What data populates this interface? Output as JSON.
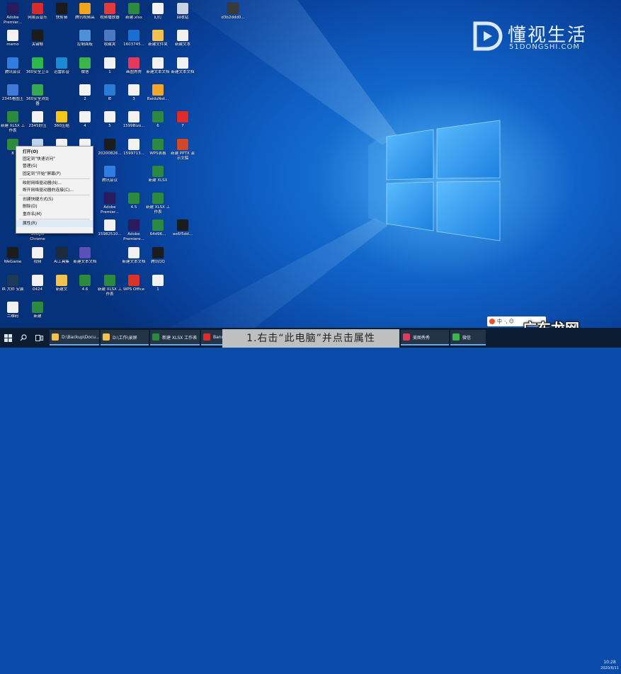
{
  "desktop_icons": [
    {
      "label": "Adobe Premier...",
      "color": "#2a1a5e"
    },
    {
      "label": "网易云音乐",
      "color": "#d62b2b"
    },
    {
      "label": "快剪辑",
      "color": "#1b1b1b"
    },
    {
      "label": "腾讯视频高",
      "color": "#f2a41c"
    },
    {
      "label": "视频播放器",
      "color": "#e33b3b"
    },
    {
      "label": "新建.xlsx",
      "color": "#2b8a3e"
    },
    {
      "label": "幻灯",
      "color": "#f2f2f2"
    },
    {
      "label": "回收站",
      "color": "#c8d4e0"
    },
    {
      "label": "d3b2ddd0...",
      "color": "#3a3a3a"
    },
    {
      "label": "memo",
      "color": "#f2f2f2"
    },
    {
      "label": "关键帧",
      "color": "#1c1c1c"
    },
    {
      "label": "控制面板",
      "color": "#4f8fd6"
    },
    {
      "label": "收藏夹",
      "color": "#4a78c2"
    },
    {
      "label": "1603745...",
      "color": "#1a6fd1"
    },
    {
      "label": "新建文件夹",
      "color": "#f2c14e"
    },
    {
      "label": "新建文本",
      "color": "#f2f2f2"
    },
    {
      "label": "腾讯会议",
      "color": "#2f7de1"
    },
    {
      "label": "360安全卫士",
      "color": "#2db84b"
    },
    {
      "label": "迅雷影音",
      "color": "#1a8ad4"
    },
    {
      "label": "微信",
      "color": "#3bb54a"
    },
    {
      "label": "1",
      "color": "#f2f2f2"
    },
    {
      "label": "画图秀秀",
      "color": "#e23a5c"
    },
    {
      "label": "新建文本文档",
      "color": "#f2f2f2"
    },
    {
      "label": "新建文本文档",
      "color": "#f2f2f2"
    },
    {
      "label": "2345看图王",
      "color": "#3f7ad8"
    },
    {
      "label": "360安全浏览器",
      "color": "#35a852"
    },
    {
      "label": "2",
      "color": "#f2f2f2"
    },
    {
      "label": "IE",
      "color": "#2a7bd6"
    },
    {
      "label": "3",
      "color": "#f2f2f2"
    },
    {
      "label": "BaiduNet...",
      "color": "#f2a62b"
    },
    {
      "label": "新建 XLSX 工作表",
      "color": "#2b8a3e"
    },
    {
      "label": "2345好压",
      "color": "#f2f2f2"
    },
    {
      "label": "360压缩",
      "color": "#f5c518"
    },
    {
      "label": "4",
      "color": "#f2f2f2"
    },
    {
      "label": "5",
      "color": "#f2f2f2"
    },
    {
      "label": "1599Bizo...",
      "color": "#f2f2f2"
    },
    {
      "label": "6",
      "color": "#2b8a3e"
    },
    {
      "label": "7",
      "color": "#e02b2b"
    },
    {
      "label": "8",
      "color": "#2b8a3e"
    },
    {
      "label": "此电脑",
      "color": "#bcd3ea"
    },
    {
      "label": "2",
      "color": "#f2f2f2"
    },
    {
      "label": "3",
      "color": "#f2f2f2"
    },
    {
      "label": "20200826...",
      "color": "#1c1c1c"
    },
    {
      "label": "1599713...",
      "color": "#f2f2f2"
    },
    {
      "label": "WPS表格",
      "color": "#2b8a3e"
    },
    {
      "label": "新建 PPTX 演示文稿",
      "color": "#d24726"
    },
    {
      "label": "腾讯会议",
      "color": "#2f7de1"
    },
    {
      "label": "新建 XLSX",
      "color": "#2b8a3e"
    },
    {
      "label": "Adobe Premier...",
      "color": "#2a1a5e"
    },
    {
      "label": "4.5",
      "color": "#2b8a3e"
    },
    {
      "label": "新建 XLSX 工作表",
      "color": "#2b8a3e"
    },
    {
      "label": "Google Chrome",
      "color": "#e8b21c"
    },
    {
      "label": "15982510...",
      "color": "#f2f2f2"
    },
    {
      "label": "Adobe Premiere...",
      "color": "#2a1a5e"
    },
    {
      "label": "64d96...",
      "color": "#2b8a3e"
    },
    {
      "label": "ee6f5dd...",
      "color": "#1c1c1c"
    },
    {
      "label": "WeGame",
      "color": "#1c1c1c"
    },
    {
      "label": "视频",
      "color": "#f2f2f2"
    },
    {
      "label": "Ai工具集",
      "color": "#1c2b3a"
    },
    {
      "label": "新建文本文档",
      "color": "#5b4fb8"
    },
    {
      "label": "新建文本文档",
      "color": "#f2f2f2"
    },
    {
      "label": "腾讯QQ",
      "color": "#1c1c1c"
    },
    {
      "label": "IR 大师 安装",
      "color": "#1c3b5a"
    },
    {
      "label": "0424",
      "color": "#f2f2f2"
    },
    {
      "label": "新建文",
      "color": "#f2c14e"
    },
    {
      "label": "4.6",
      "color": "#2b8a3e"
    },
    {
      "label": "新建 XLSX 工作表",
      "color": "#2b8a3e"
    },
    {
      "label": "WPS Office",
      "color": "#d8342a"
    },
    {
      "label": "1",
      "color": "#f2f2f2"
    },
    {
      "label": "二维码",
      "color": "#f2f2f2"
    },
    {
      "label": "新建",
      "color": "#2b8a3e"
    }
  ],
  "context_menu": {
    "items": [
      {
        "label": "打开(O)",
        "bold": true
      },
      {
        "label": "固定到\"快速访问\"",
        "bold": false
      },
      {
        "label": "管理(G)",
        "bold": false
      },
      {
        "label": "固定到\"开始\"屏幕(P)",
        "bold": false
      },
      {
        "separator": true
      },
      {
        "label": "映射网络驱动器(N)...",
        "bold": false
      },
      {
        "label": "断开网络驱动器的连接(C)...",
        "bold": false
      },
      {
        "separator": true
      },
      {
        "label": "创建快捷方式(S)",
        "bold": false
      },
      {
        "label": "删除(D)",
        "bold": false
      },
      {
        "label": "重命名(M)",
        "bold": false
      },
      {
        "separator": true
      },
      {
        "label": "属性(R)",
        "bold": false,
        "highlighted": true
      }
    ]
  },
  "brand": {
    "name_cn": "懂视生活",
    "name_en": "51DONGSHI.COM"
  },
  "taskbar": {
    "items": [
      {
        "label": "D:\\Backup\\Docu...",
        "color": "#f2c14e"
      },
      {
        "label": "D:\\工作\\录屏",
        "color": "#f2c14e"
      },
      {
        "label": "新建 XLSX 工作表",
        "color": "#2b8a3e"
      },
      {
        "label": "Bandic...",
        "color": "#e02b2b"
      },
      {
        "label": "美图秀秀",
        "color": "#e23a5c"
      },
      {
        "label": "微信",
        "color": "#3bb54a"
      }
    ],
    "clock_time": "10:28",
    "clock_date": "2020/6/11"
  },
  "ime_bar": {
    "label": "中",
    "extra": "·, ☺"
  },
  "subtitle": "1.右击“此电脑”并点击属性",
  "watermark": "广东龙网"
}
